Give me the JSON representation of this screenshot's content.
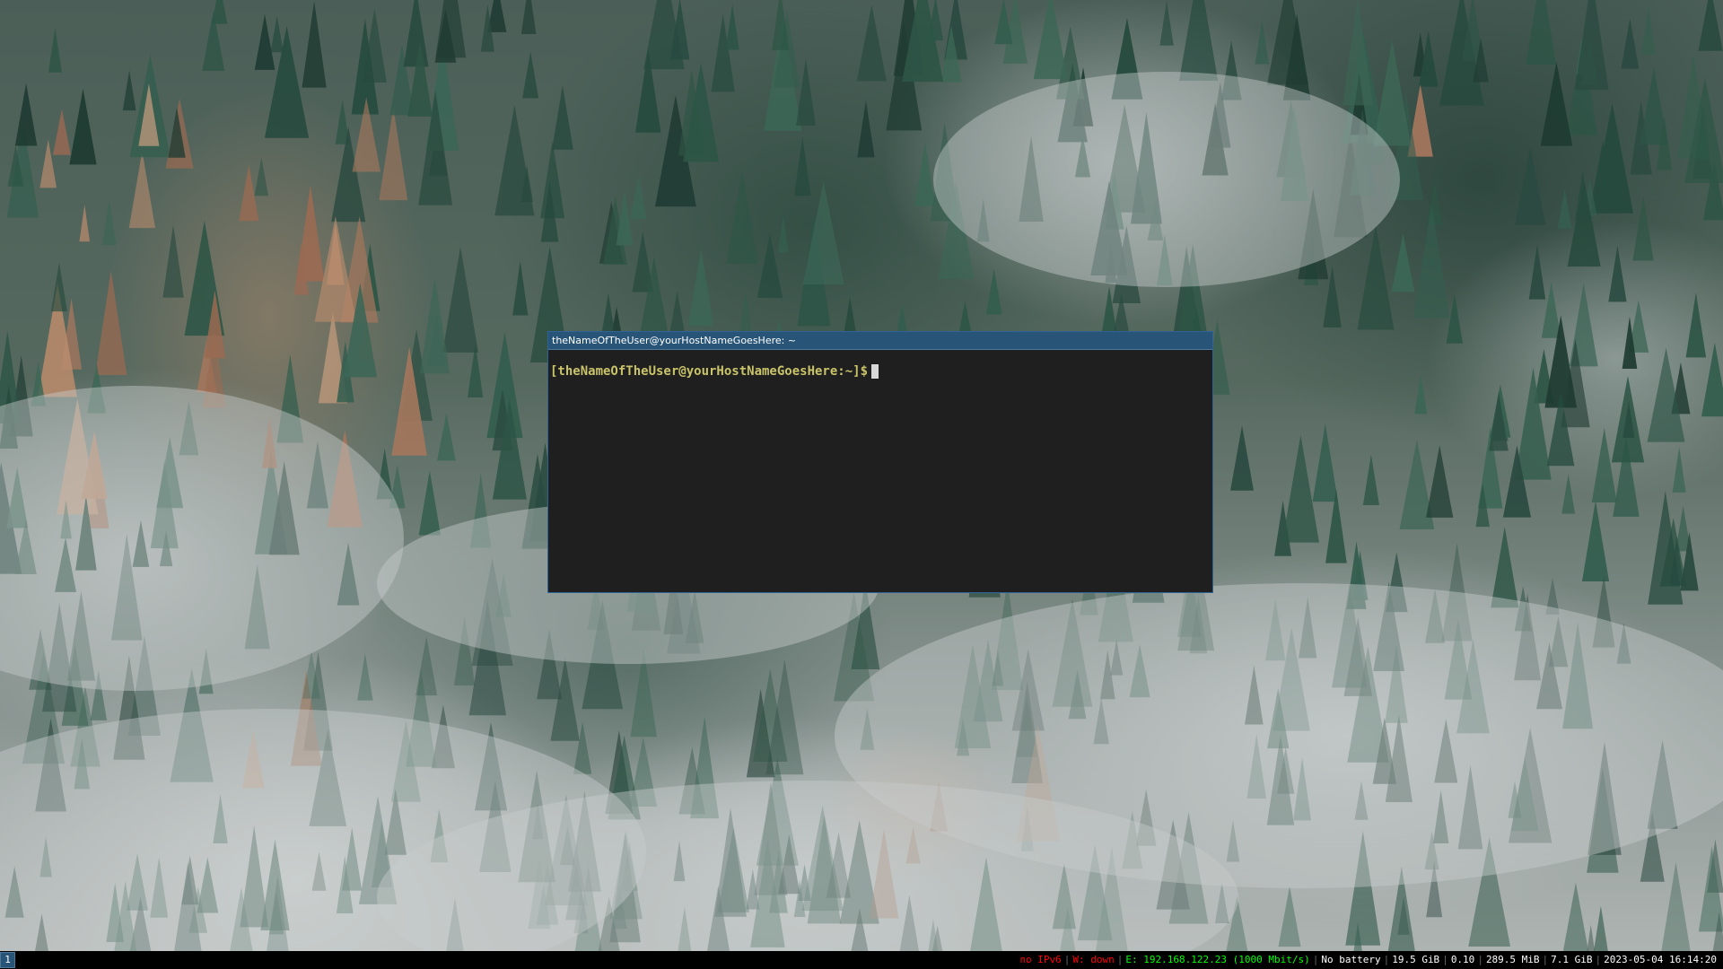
{
  "terminal": {
    "title": "theNameOfTheUser@yourHostNameGoesHere: ~",
    "prompt": "[theNameOfTheUser@yourHostNameGoesHere:~]$"
  },
  "statusbar": {
    "workspace": "1",
    "items": {
      "ipv6": "no IPv6",
      "wireless": "W: down",
      "ethernet": "E: 192.168.122.23 (1000 Mbit/s)",
      "battery": "No battery",
      "disk": "19.5 GiB",
      "load": "0.10",
      "memory_used": "289.5 MiB",
      "memory_total": "7.1 GiB",
      "datetime": "2023-05-04 16:14:20"
    },
    "colors": {
      "bad": "#ff0000",
      "good": "#00ff00",
      "neutral": "#ffffff"
    }
  },
  "colors": {
    "titlebar_focused": "#285577",
    "terminal_bg": "#1f1f1f",
    "prompt": "#c9c36a"
  }
}
